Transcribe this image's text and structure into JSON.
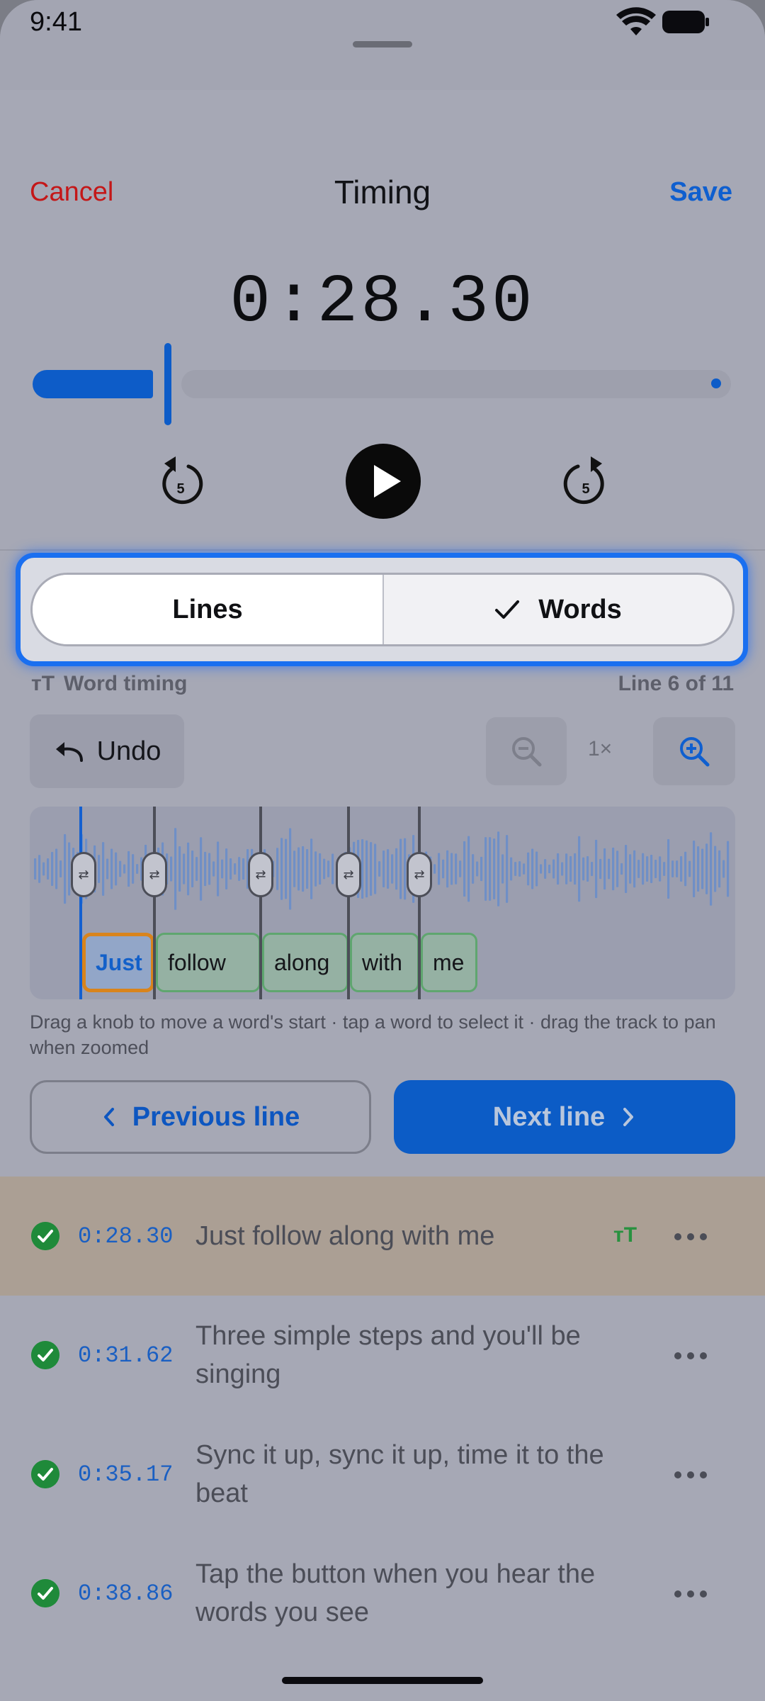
{
  "status_bar": {
    "time": "9:41"
  },
  "nav": {
    "cancel": "Cancel",
    "title": "Timing",
    "save": "Save"
  },
  "player": {
    "current_time": "0:28.30",
    "progress": 0.19
  },
  "segmented": {
    "lines": "Lines",
    "words": "Words",
    "selected": "Words"
  },
  "word_timing": {
    "title": "Word timing",
    "line_indicator": "Line 6 of 11",
    "undo": "Undo",
    "zoom_level": "1×",
    "words": [
      {
        "text": "Just",
        "selected": true
      },
      {
        "text": "follow",
        "selected": false
      },
      {
        "text": "along",
        "selected": false
      },
      {
        "text": "with",
        "selected": false
      },
      {
        "text": "me",
        "selected": false
      }
    ],
    "hint": "Drag a knob to move a word's start · tap a word to select it · drag the track to pan when zoomed"
  },
  "nav_buttons": {
    "previous": "Previous line",
    "next": "Next line"
  },
  "lines": [
    {
      "time": "0:28.30",
      "text": "Just follow along with me",
      "active": true,
      "word_timed": true
    },
    {
      "time": "0:31.62",
      "text": "Three simple steps and you'll be singing",
      "active": false,
      "word_timed": false
    },
    {
      "time": "0:35.17",
      "text": "Sync it up, sync it up, time it to the beat",
      "active": false,
      "word_timed": false
    },
    {
      "time": "0:38.86",
      "text": "Tap the button when you hear the words you see",
      "active": false,
      "word_timed": false
    }
  ],
  "colors": {
    "accent": "#0f5fcf",
    "cancel": "#c41718",
    "done": "#1f8a3a",
    "selected_word_border": "#d9841c"
  }
}
